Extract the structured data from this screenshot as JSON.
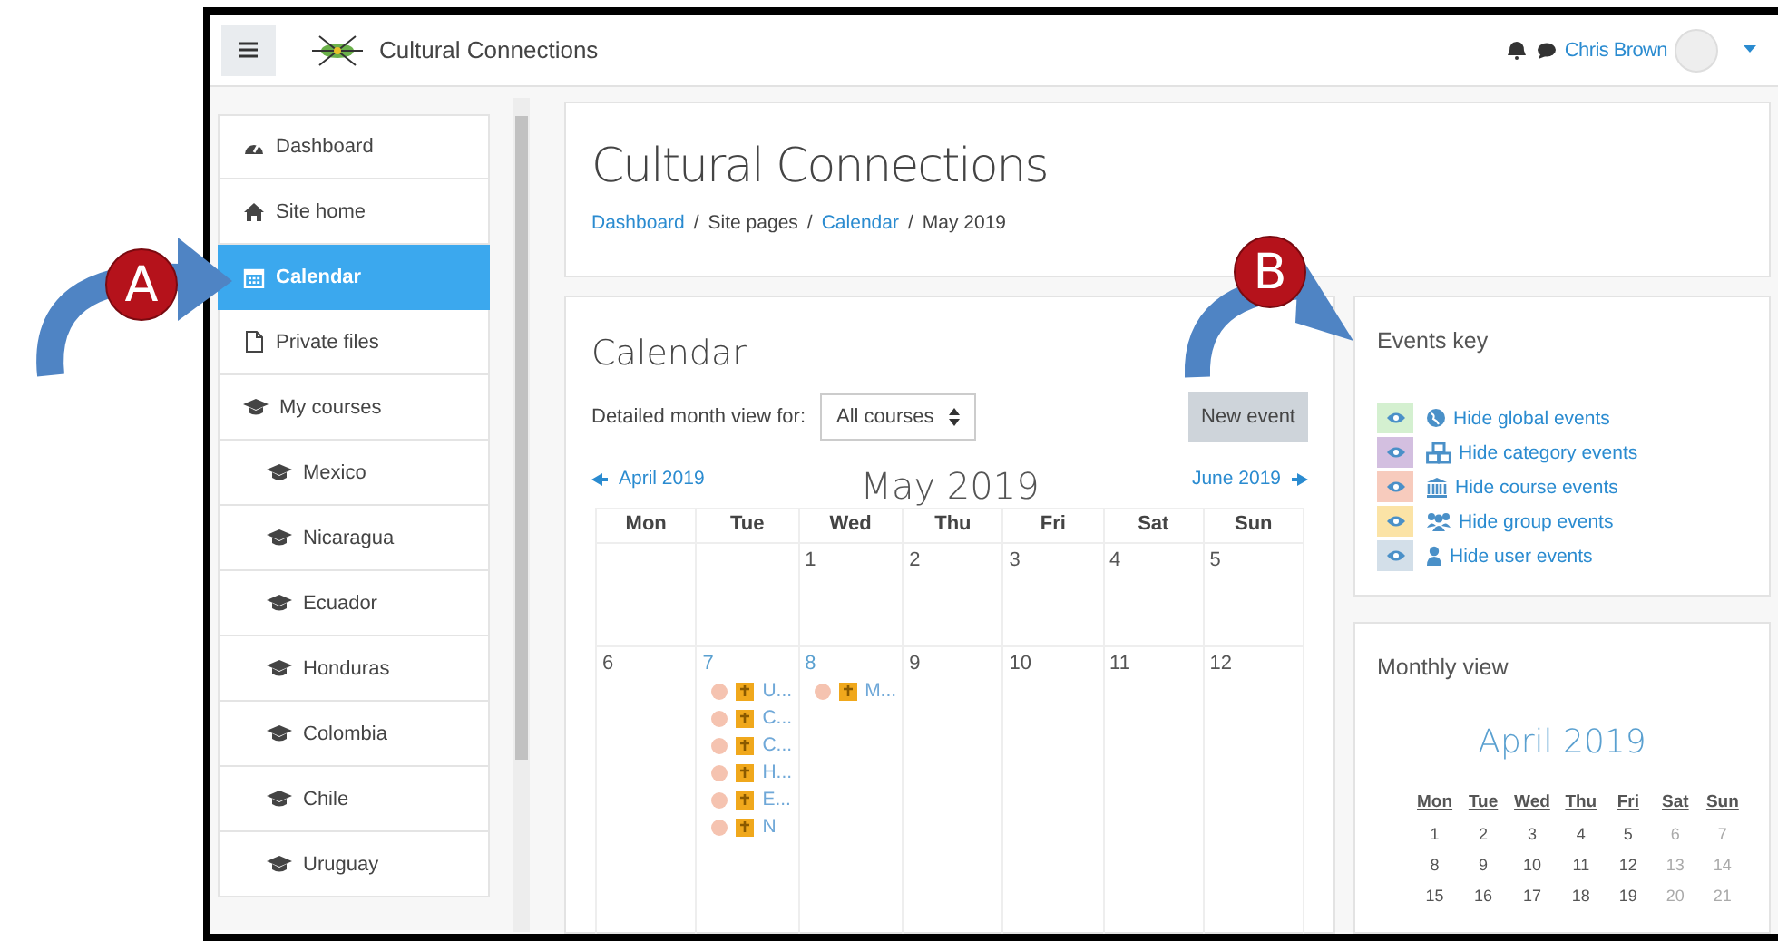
{
  "navbar": {
    "site_name": "Cultural Connections",
    "user_name": "Chris Brown"
  },
  "sidebar": {
    "items": [
      {
        "label": "Dashboard",
        "kind": "dashboard",
        "selected": false
      },
      {
        "label": "Site home",
        "kind": "home",
        "selected": false
      },
      {
        "label": "Calendar",
        "kind": "calendar",
        "selected": true
      },
      {
        "label": "Private files",
        "kind": "file",
        "selected": false
      },
      {
        "label": "My courses",
        "kind": "course",
        "selected": false,
        "children": [
          {
            "label": "Mexico",
            "kind": "course",
            "selected": false
          },
          {
            "label": "Nicaragua",
            "kind": "course",
            "selected": false
          },
          {
            "label": "Ecuador",
            "kind": "course",
            "selected": false
          },
          {
            "label": "Honduras",
            "kind": "course",
            "selected": false
          },
          {
            "label": "Colombia",
            "kind": "course",
            "selected": false
          },
          {
            "label": "Chile",
            "kind": "course",
            "selected": false
          },
          {
            "label": "Uruguay",
            "kind": "course",
            "selected": false
          }
        ]
      }
    ]
  },
  "header": {
    "title": "Cultural Connections",
    "separator": "/",
    "breadcrumb": [
      {
        "label": "Dashboard",
        "link": true
      },
      {
        "label": "Site pages",
        "link": false
      },
      {
        "label": "Calendar",
        "link": true
      },
      {
        "label": "May 2019",
        "link": false
      }
    ]
  },
  "calendar": {
    "title": "Calendar",
    "filter_label": "Detailed month view for:",
    "filter_value": "All courses",
    "new_event_button": "New event",
    "prev_month": "April 2019",
    "month": "May 2019",
    "next_month": "June 2019",
    "weekdays": [
      "Mon",
      "Tue",
      "Wed",
      "Thu",
      "Fri",
      "Sat",
      "Sun"
    ],
    "weeks": [
      [
        {
          "kind": "blank"
        },
        {
          "kind": "blank"
        },
        {
          "kind": "day",
          "day": "1",
          "link": false
        },
        {
          "kind": "day",
          "day": "2",
          "link": false
        },
        {
          "kind": "day",
          "day": "3",
          "link": false
        },
        {
          "kind": "day",
          "day": "4",
          "link": false
        },
        {
          "kind": "day",
          "day": "5",
          "link": false
        }
      ],
      [
        {
          "kind": "day",
          "day": "6",
          "link": false
        },
        {
          "kind": "day",
          "day": "7",
          "link": true,
          "events": [
            "U...",
            "C...",
            "C...",
            "H...",
            "E...",
            "N"
          ]
        },
        {
          "kind": "day",
          "day": "8",
          "link": true,
          "events": [
            "M..."
          ]
        },
        {
          "kind": "day",
          "day": "9",
          "link": false
        },
        {
          "kind": "day",
          "day": "10",
          "link": false
        },
        {
          "kind": "day",
          "day": "11",
          "link": false
        },
        {
          "kind": "day",
          "day": "12",
          "link": false
        }
      ]
    ]
  },
  "events_key": {
    "title": "Events key",
    "items": [
      {
        "label": "Hide global events",
        "kind": "global",
        "color": "#d4f0d0"
      },
      {
        "label": "Hide category events",
        "kind": "category",
        "color": "#d3bfe0"
      },
      {
        "label": "Hide course events",
        "kind": "course",
        "color": "#f7cbbd"
      },
      {
        "label": "Hide group events",
        "kind": "group",
        "color": "#fbe3a6"
      },
      {
        "label": "Hide user events",
        "kind": "user",
        "color": "#d3dfe9"
      }
    ]
  },
  "monthly_view": {
    "title": "Monthly view",
    "month": "April 2019",
    "weekdays": [
      "Mon",
      "Tue",
      "Wed",
      "Thu",
      "Fri",
      "Sat",
      "Sun"
    ],
    "weeks": [
      [
        "1",
        "2",
        "3",
        "4",
        "5",
        "6",
        "7"
      ],
      [
        "8",
        "9",
        "10",
        "11",
        "12",
        "13",
        "14"
      ],
      [
        "15",
        "16",
        "17",
        "18",
        "19",
        "20",
        "21"
      ]
    ]
  },
  "annotations": [
    {
      "letter": "A"
    },
    {
      "letter": "B"
    }
  ]
}
